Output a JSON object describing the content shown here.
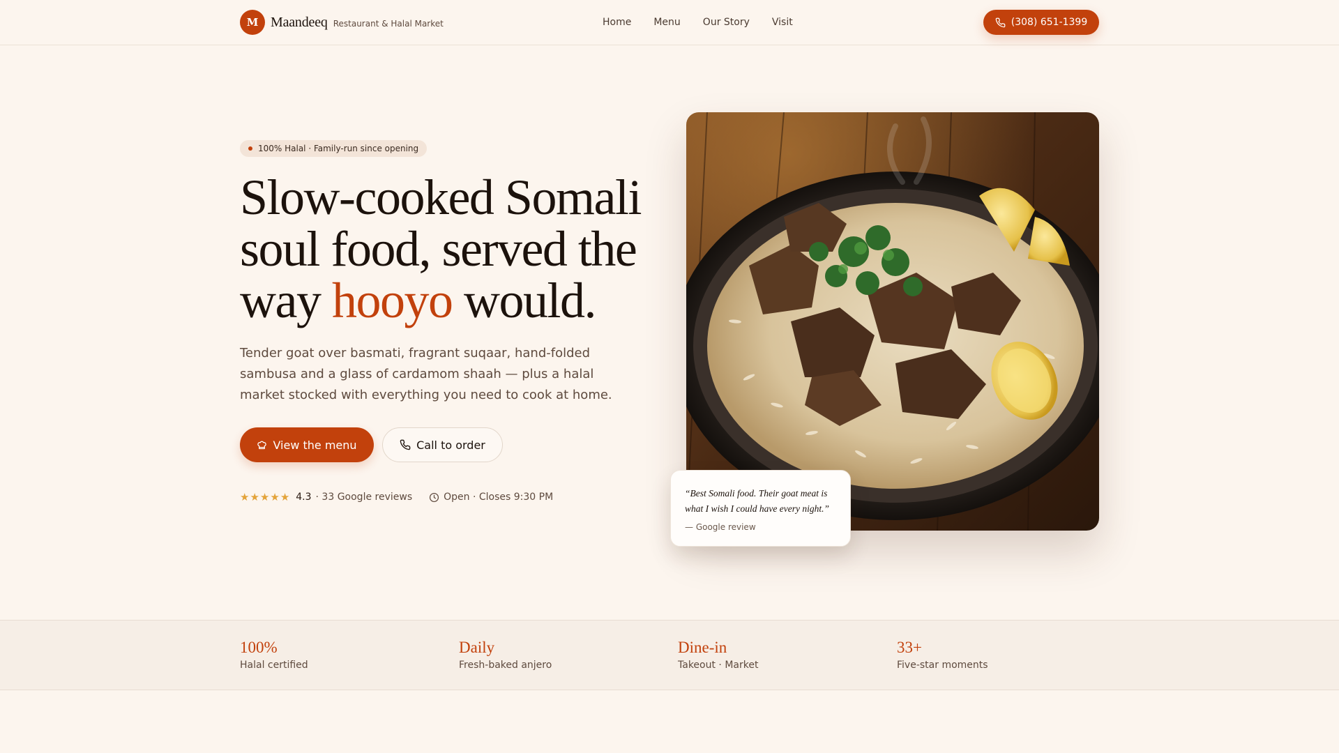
{
  "nav": {
    "brand_initial": "M",
    "brand_name": "Maandeeq",
    "brand_tagline": "Restaurant & Halal Market",
    "links": [
      "Home",
      "Menu",
      "Our Story",
      "Visit"
    ],
    "phone_label": "(308) 651-1399"
  },
  "hero": {
    "badge": "100% Halal · Family-run since opening",
    "headline_part1": "Slow-cooked Somali soul food, served the way ",
    "headline_accent": "hooyo",
    "headline_part2": " would.",
    "lede": "Tender goat over basmati, fragrant suqaar, hand-folded sambusa and a glass of cardamom shaah — plus a halal market stocked with everything you need to cook at home.",
    "primary_cta": "View the menu",
    "secondary_cta": "Call to order",
    "rating_stars": 4.3,
    "rating_value": "4.3",
    "reviews_text": "· 33 Google reviews",
    "hours_text": "Open · Closes 9:30 PM"
  },
  "photo": {
    "icon": "goat-rice-plate-photo"
  },
  "quote": {
    "text": "“Best Somali food. Their goat meat is what I wish I could have every night.”",
    "source": "— Google review"
  },
  "stats": [
    {
      "value": "100%",
      "label": "Halal certified"
    },
    {
      "value": "Daily",
      "label": "Fresh-baked anjero"
    },
    {
      "value": "Dine-in",
      "label": "Takeout · Market"
    },
    {
      "value": "33+",
      "label": "Five-star moments"
    }
  ],
  "colors": {
    "accent": "#c2410c",
    "background": "#fcf5ee",
    "star": "#e3a33a"
  }
}
